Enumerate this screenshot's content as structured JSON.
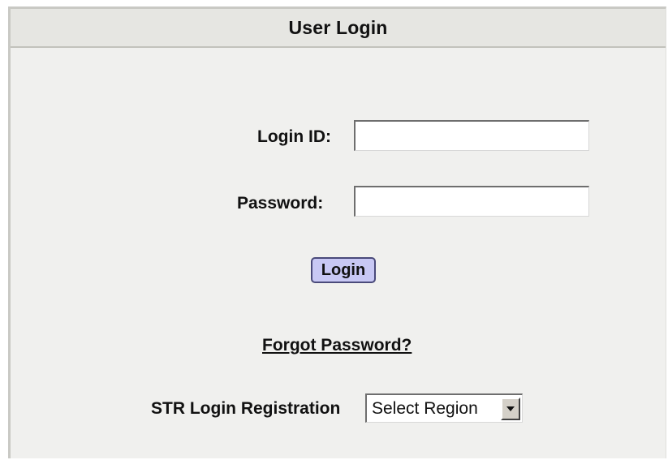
{
  "header": {
    "title": "User Login"
  },
  "form": {
    "login_id_label": "Login ID:",
    "login_id_value": "",
    "password_label": "Password:",
    "password_value": "",
    "login_button": "Login",
    "forgot_password": "Forgot Password?",
    "registration_label": "STR Login Registration",
    "region_select_value": "Select Region",
    "region_arrow_icon": "chevron-down-icon"
  },
  "colors": {
    "panel_background": "#f0f0ee",
    "header_background": "#e6e6e2",
    "button_background": "#c8c8f4"
  }
}
